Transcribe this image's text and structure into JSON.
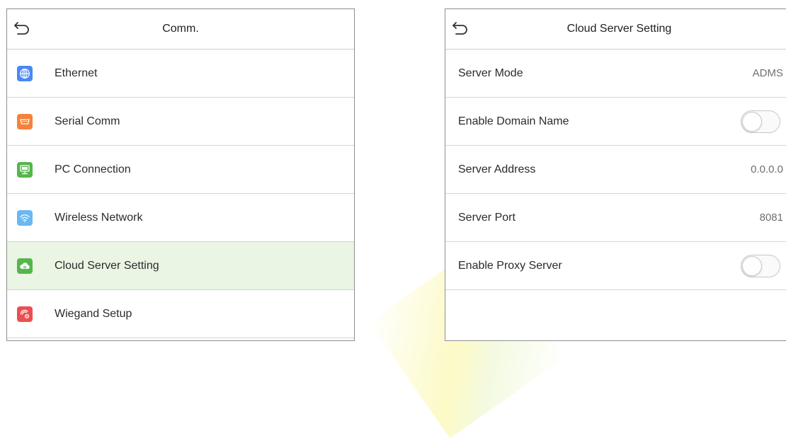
{
  "left_panel": {
    "title": "Comm.",
    "items": [
      {
        "label": "Ethernet",
        "icon": "globe-icon",
        "color": "#4b88f4"
      },
      {
        "label": "Serial Comm",
        "icon": "serial-port-icon",
        "color": "#f5823b"
      },
      {
        "label": "PC Connection",
        "icon": "monitor-icon",
        "color": "#56b54d"
      },
      {
        "label": "Wireless Network",
        "icon": "wifi-icon",
        "color": "#6bb8f2"
      },
      {
        "label": "Cloud Server Setting",
        "icon": "cloud-icon",
        "color": "#56b54d",
        "selected": true
      },
      {
        "label": "Wiegand Setup",
        "icon": "wiegand-icon",
        "color": "#ec4f4f"
      }
    ]
  },
  "right_panel": {
    "title": "Cloud Server Setting",
    "rows": [
      {
        "label": "Server Mode",
        "value": "ADMS",
        "type": "value"
      },
      {
        "label": "Enable Domain Name",
        "type": "toggle",
        "on": false
      },
      {
        "label": "Server Address",
        "value": "0.0.0.0",
        "type": "value"
      },
      {
        "label": "Server Port",
        "value": "8081",
        "type": "value"
      },
      {
        "label": "Enable Proxy Server",
        "type": "toggle",
        "on": false
      }
    ]
  },
  "colors": {
    "selected_row": "#eaf5e4",
    "border": "#8f8f8f"
  }
}
